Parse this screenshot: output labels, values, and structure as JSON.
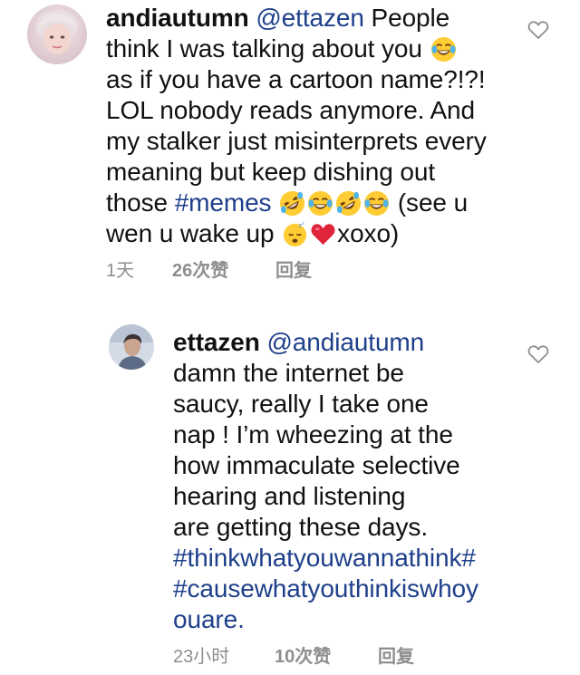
{
  "comments": [
    {
      "username": "andiautumn",
      "lines": [
        {
          "mention": "@ettazen",
          "text": " People"
        },
        {
          "text": "think I was talking about you "
        },
        {
          "text": "as if you have a cartoon name?!?!"
        },
        {
          "text": "LOL nobody reads anymore. And"
        },
        {
          "text": "my stalker just misinterprets every"
        },
        {
          "text": "meaning but keep dishing out"
        },
        {
          "text_before": "those ",
          "hashtag": "#memes",
          "text_after": " (see u"
        },
        {
          "text_before": "wen u wake up ",
          "text_after": "xoxo)"
        }
      ],
      "emojis": [
        "face-with-tears-of-joy",
        "rolling-on-floor-laughing",
        "sleeping-face",
        "red-heart"
      ],
      "time": "1天",
      "likes": "26次赞",
      "reply": "回复"
    },
    {
      "username": "ettazen",
      "lines": [
        {
          "mention": "@andiautumn"
        },
        {
          "text": "damn the internet be"
        },
        {
          "text": "saucy, really  I take one"
        },
        {
          "text": "nap ! I’m wheezing at the"
        },
        {
          "text": "how immaculate selective"
        },
        {
          "text": "hearing and listening"
        },
        {
          "text": "are getting these days."
        },
        {
          "hashtag": "#thinkwhatyouwannathink#"
        },
        {
          "hashtag": "#causewhatyouthinkiswhoy"
        },
        {
          "hashtag": "ouare."
        }
      ],
      "time": "23小时",
      "likes": "10次赞",
      "reply": "回复"
    }
  ],
  "colors": {
    "text": "#111111",
    "link": "#1e3f8a",
    "meta": "#8e8e8e",
    "background": "#ffffff"
  }
}
